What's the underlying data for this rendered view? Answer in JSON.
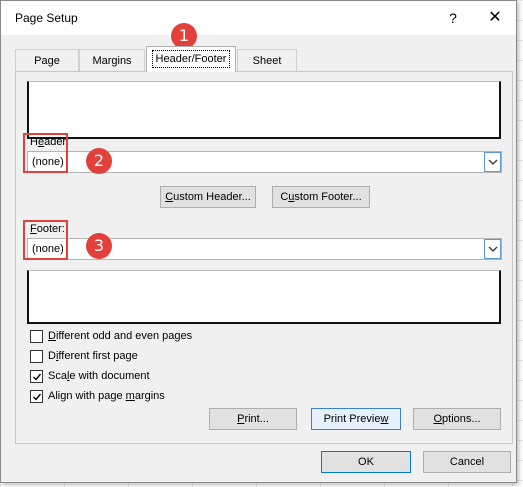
{
  "dialog": {
    "title": "Page Setup",
    "help_label": "?",
    "close_label": "✕"
  },
  "tabs": [
    {
      "label": "Page"
    },
    {
      "label": "Margins"
    },
    {
      "label": "Header/Footer",
      "active": true
    },
    {
      "label": "Sheet"
    }
  ],
  "header": {
    "label_first": "H",
    "label_ul": "e",
    "label_rest": "ader:",
    "value": "(none)"
  },
  "custom_header_button": {
    "ul": "C",
    "rest": "ustom Header..."
  },
  "custom_footer_button": {
    "pre": "C",
    "ul": "u",
    "rest": "stom Footer..."
  },
  "footer": {
    "label_ul": "F",
    "label_rest": "ooter:",
    "value": "(none)"
  },
  "options": [
    {
      "ul": "D",
      "rest": "ifferent odd and even pages",
      "checked": false
    },
    {
      "pre": "D",
      "ul": "i",
      "rest": "fferent first page",
      "checked": false
    },
    {
      "pre": "Sca",
      "ul": "l",
      "rest": "e with document",
      "checked": true
    },
    {
      "pre": "Align with page ",
      "ul": "m",
      "rest": "argins",
      "checked": true
    }
  ],
  "print_button": {
    "ul": "P",
    "rest": "rint..."
  },
  "print_preview_button": {
    "pre": "Print Previe",
    "ul": "w",
    "rest": ""
  },
  "options_button": {
    "ul": "O",
    "rest": "ptions..."
  },
  "ok_button": "OK",
  "cancel_button": "Cancel",
  "callouts": [
    "1",
    "2",
    "3"
  ],
  "colors": {
    "callout": "#e2413b",
    "focus_border": "#0078d7"
  }
}
